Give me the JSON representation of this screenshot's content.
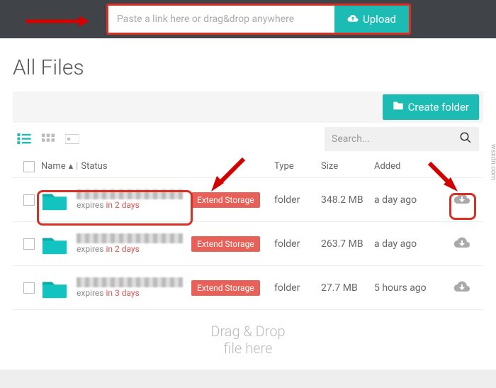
{
  "header": {
    "url_placeholder": "Paste a link here or drag&drop anywhere",
    "upload_label": "Upload"
  },
  "page": {
    "title": "All Files",
    "create_folder_label": "Create folder",
    "search_placeholder": "Search..."
  },
  "columns": {
    "name": "Name",
    "status": "Status",
    "type": "Type",
    "size": "Size",
    "added": "Added"
  },
  "rows": [
    {
      "expires_prefix": "expires ",
      "expires_value": "in 2 days",
      "extend_label": "Extend Storage",
      "type": "folder",
      "size": "348.2 MB",
      "added": "a day ago"
    },
    {
      "expires_prefix": "expires ",
      "expires_value": "in 2 days",
      "extend_label": "Extend Storage",
      "type": "folder",
      "size": "263.7 MB",
      "added": "a day ago"
    },
    {
      "expires_prefix": "expires ",
      "expires_value": "in 3 days",
      "extend_label": "Extend Storage",
      "type": "folder",
      "size": "27.7 MB",
      "added": "5 hours ago"
    }
  ],
  "dropzone": {
    "line1": "Drag & Drop",
    "line2": "file here"
  },
  "watermark": "wsxdn.com"
}
